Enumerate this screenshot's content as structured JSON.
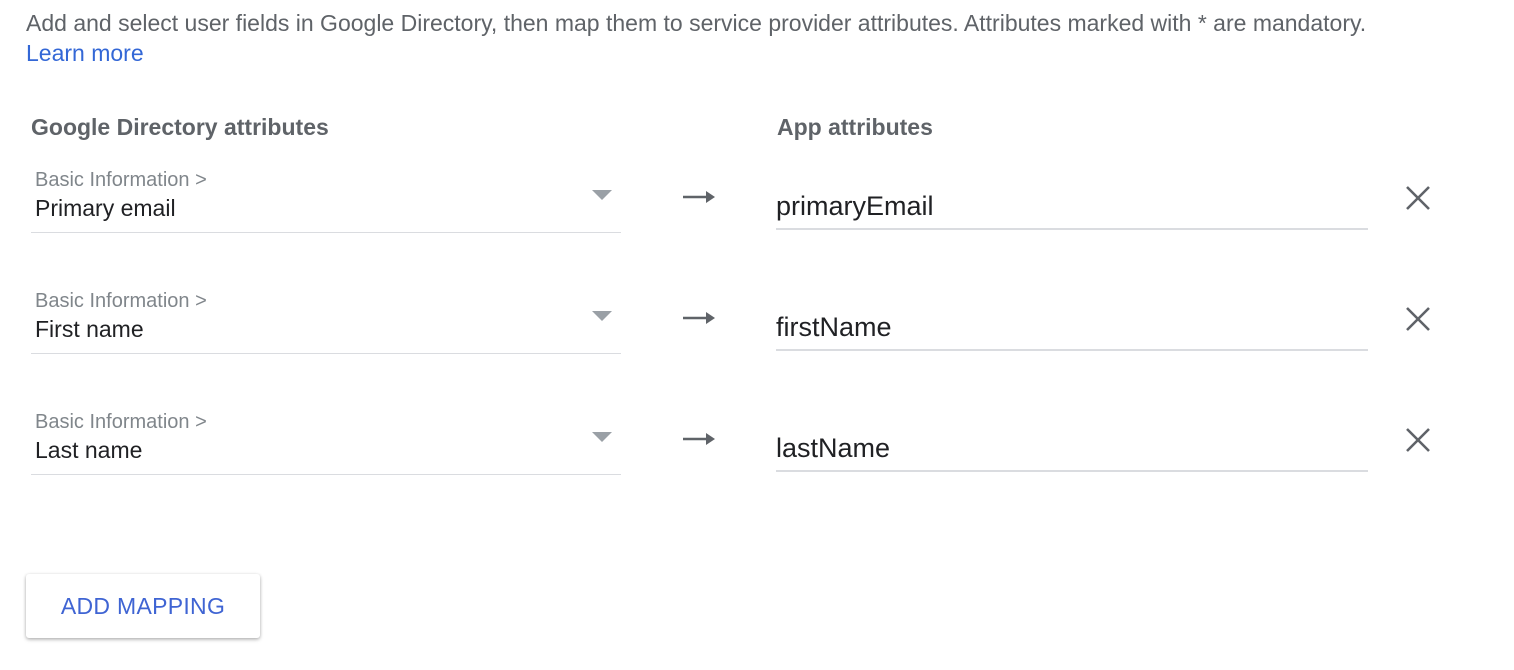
{
  "intro": {
    "text": "Add and select user fields in Google Directory, then map them to service provider attributes. Attributes marked with * are mandatory.",
    "learn_more": "Learn more"
  },
  "headers": {
    "directory": "Google Directory attributes",
    "app": "App attributes"
  },
  "mappings": [
    {
      "category": "Basic Information >",
      "field": "Primary email",
      "app_attribute": "primaryEmail"
    },
    {
      "category": "Basic Information >",
      "field": "First name",
      "app_attribute": "firstName"
    },
    {
      "category": "Basic Information >",
      "field": "Last name",
      "app_attribute": "lastName"
    }
  ],
  "icons": {
    "dropdown": "chevron-down-icon",
    "arrow": "arrow-right-icon",
    "remove": "close-icon"
  },
  "actions": {
    "add_mapping": "ADD MAPPING"
  },
  "colors": {
    "link": "#3367d6",
    "button_text": "#3f64d3",
    "secondary_text": "#5f6368"
  }
}
